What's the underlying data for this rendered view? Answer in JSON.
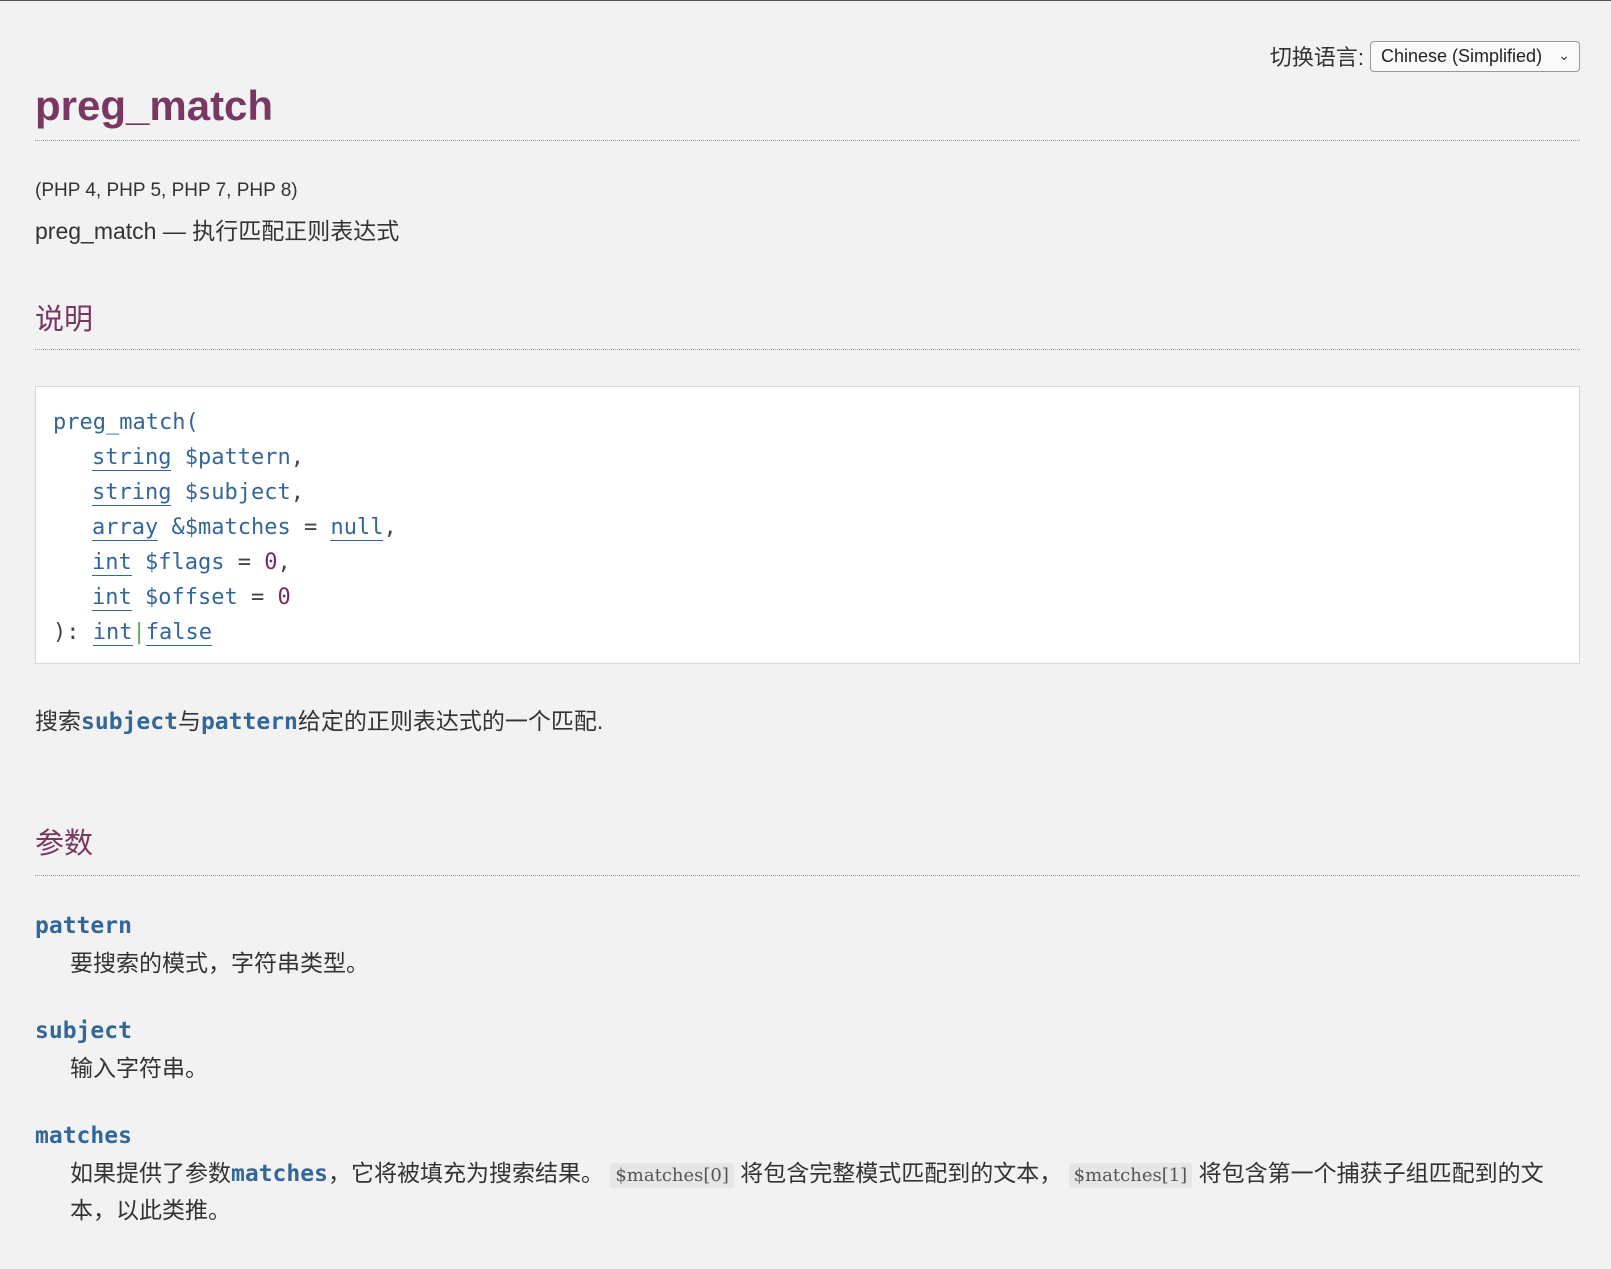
{
  "language_switcher": {
    "label": "切换语言:",
    "selected": "Chinese (Simplified)"
  },
  "title": "preg_match",
  "versions": "(PHP 4, PHP 5, PHP 7, PHP 8)",
  "refpurpose": "preg_match — 执行匹配正则表达式",
  "sections": {
    "description_heading": "说明",
    "parameters_heading": "参数"
  },
  "synopsis": {
    "fn_open": "preg_match(",
    "params": [
      {
        "type": "string",
        "name": "$pattern",
        "default": "",
        "suffix": ","
      },
      {
        "type": "string",
        "name": "$subject",
        "default": "",
        "suffix": ","
      },
      {
        "type": "array",
        "name": "&$matches",
        "default": "null",
        "suffix": ","
      },
      {
        "type": "int",
        "name": "$flags",
        "default": "0",
        "suffix": ","
      },
      {
        "type": "int",
        "name": "$offset",
        "default": "0",
        "suffix": ""
      }
    ],
    "close": "): ",
    "return_types": [
      "int",
      "false"
    ]
  },
  "description": {
    "prefix": "搜索",
    "param1": "subject",
    "mid": "与",
    "param2": "pattern",
    "suffix": "给定的正则表达式的一个匹配."
  },
  "parameters": [
    {
      "name": "pattern",
      "desc": "要搜索的模式，字符串类型。"
    },
    {
      "name": "subject",
      "desc": "输入字符串。"
    },
    {
      "name": "matches",
      "desc_prefix": "如果提供了参数",
      "desc_param": "matches",
      "desc_mid1": "，它将被填充为搜索结果。 ",
      "code1": "$matches[0]",
      "desc_mid2": " 将包含完整模式匹配到的文本， ",
      "code2": "$matches[1]",
      "desc_suffix": " 将包含第一个捕获子组匹配到的文本，以此类推。"
    }
  ]
}
